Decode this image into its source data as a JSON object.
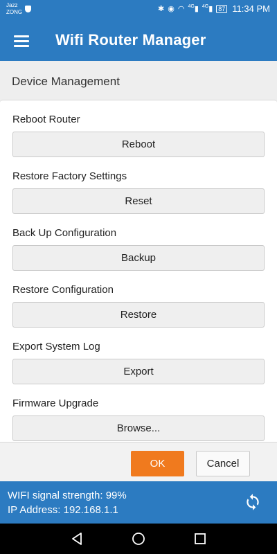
{
  "status_bar": {
    "carrier_line1": "Jazz",
    "carrier_line2": "ZONG",
    "battery": "87",
    "network_badge_1": "4G",
    "network_badge_2": "4G",
    "time": "11:34 PM"
  },
  "app_bar": {
    "title": "Wifi Router Manager",
    "menu_icon": "hamburger-menu-icon"
  },
  "section_title": "Device Management",
  "rows": [
    {
      "label": "Reboot Router",
      "button": "Reboot"
    },
    {
      "label": "Restore Factory Settings",
      "button": "Reset"
    },
    {
      "label": "Back Up Configuration",
      "button": "Backup"
    },
    {
      "label": "Restore Configuration",
      "button": "Restore"
    },
    {
      "label": "Export System Log",
      "button": "Export"
    },
    {
      "label": "Firmware Upgrade",
      "button": "Browse..."
    }
  ],
  "footer": {
    "ok_label": "OK",
    "cancel_label": "Cancel"
  },
  "info": {
    "signal_text": "WIFI signal strength: 99%",
    "ip_text": "IP Address: 192.168.1.1",
    "refresh_icon": "refresh-icon"
  },
  "colors": {
    "primary": "#2c7bc1",
    "accent": "#f07a1e"
  }
}
